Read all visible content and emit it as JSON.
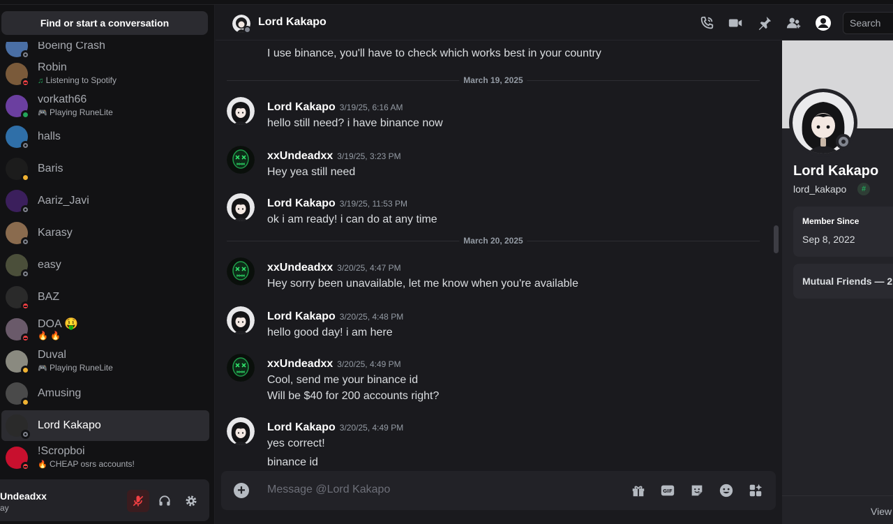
{
  "sidebar": {
    "find_label": "Find or start a conversation",
    "dms": [
      {
        "name": "Boeing Crash",
        "status": "off",
        "color": "#4a6fa5"
      },
      {
        "name": "Robin",
        "sub": "Listening to Spotify",
        "sub_icon": "♫",
        "status": "dnd",
        "color": "#7a5a3a"
      },
      {
        "name": "vorkath66",
        "sub": "Playing RuneLite",
        "sub_icon": "🎮",
        "status": "on",
        "color": "#6b3fa0"
      },
      {
        "name": "halls",
        "status": "off",
        "color": "#2f6fa8"
      },
      {
        "name": "Baris",
        "status": "idle",
        "color": "#1c1c1c"
      },
      {
        "name": "Aariz_Javi",
        "status": "off",
        "color": "#3b1f5c"
      },
      {
        "name": "Karasy",
        "status": "off",
        "color": "#8a6b4e"
      },
      {
        "name": "easy",
        "status": "off",
        "color": "#4b4f3a"
      },
      {
        "name": "BAZ",
        "status": "dnd",
        "color": "#2a2a2a"
      },
      {
        "name": "DOA 🤑",
        "sub": "🔥 🔥",
        "status": "dnd",
        "color": "#6a5a6a"
      },
      {
        "name": "Duval",
        "sub": "Playing RuneLite",
        "sub_icon": "🎮",
        "status": "idle",
        "color": "#8a8a80"
      },
      {
        "name": "Amusing",
        "status": "idle",
        "color": "#4a4a4a"
      },
      {
        "name": "Lord Kakapo",
        "status": "off",
        "color": "#2a2a2a",
        "active": true
      },
      {
        "name": "!Scropboi",
        "sub": "CHEAP osrs accounts!",
        "sub_icon": "🔥",
        "status": "dnd",
        "color": "#c8102e"
      }
    ],
    "user": {
      "name": "Undeadxx",
      "status_text": "ay"
    }
  },
  "header": {
    "title": "Lord Kakapo",
    "search_placeholder": "Search",
    "icons": [
      "phone-call-icon",
      "video-call-icon",
      "pin-icon",
      "add-friend-icon",
      "profile-icon"
    ]
  },
  "messages": {
    "top_text": "I use binance, you'll have to check which works best in your country",
    "date1": "March 19, 2025",
    "date2": "March 20, 2025",
    "list": [
      {
        "author": "Lord Kakapo",
        "time": "3/19/25, 6:16 AM",
        "lines": [
          "hello still need? i have binance now"
        ],
        "kind": "kakapo"
      },
      {
        "author": "xxUndeadxx",
        "time": "3/19/25, 3:23 PM",
        "lines": [
          "Hey yea still need"
        ],
        "kind": "undead"
      },
      {
        "author": "Lord Kakapo",
        "time": "3/19/25, 11:53 PM",
        "lines": [
          "ok i am ready! i can do at any time"
        ],
        "kind": "kakapo"
      },
      {
        "author": "xxUndeadxx",
        "time": "3/20/25, 4:47 PM",
        "lines": [
          "Hey sorry been unavailable, let me know when you're available"
        ],
        "kind": "undead"
      },
      {
        "author": "Lord Kakapo",
        "time": "3/20/25, 4:48 PM",
        "lines": [
          "hello good day! i am here"
        ],
        "kind": "kakapo"
      },
      {
        "author": "xxUndeadxx",
        "time": "3/20/25, 4:49 PM",
        "lines": [
          "Cool, send me your binance id",
          "Will be $40 for 200 accounts right?"
        ],
        "kind": "undead"
      },
      {
        "author": "Lord Kakapo",
        "time": "3/20/25, 4:49 PM",
        "lines": [
          "yes correct!",
          "binance id"
        ],
        "kind": "kakapo"
      }
    ]
  },
  "composer": {
    "placeholder": "Message @Lord Kakapo",
    "icons": [
      "gift-icon",
      "gif-icon",
      "sticker-icon",
      "emoji-icon",
      "apps-icon"
    ]
  },
  "profile": {
    "display_name": "Lord Kakapo",
    "username": "lord_kakapo",
    "badge": "#",
    "member_since_label": "Member Since",
    "member_since": "Sep 8, 2022",
    "mutual_friends": "Mutual Friends — 2",
    "footer": "View"
  }
}
